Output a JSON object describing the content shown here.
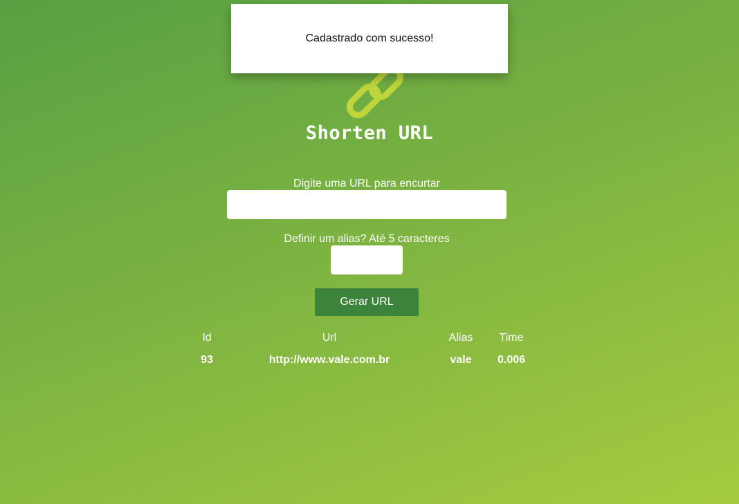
{
  "toast": {
    "message": "Cadastrado com sucesso!"
  },
  "header": {
    "logo_icon": "chain-link-icon",
    "title": "Shorten URL"
  },
  "form": {
    "url_label": "Digite uma URL para encurtar",
    "url_value": "",
    "alias_label": "Definir um alias? Até 5 caracteres",
    "alias_value": "",
    "submit_label": "Gerar URL"
  },
  "table": {
    "columns": [
      "Id",
      "Url",
      "Alias",
      "Time"
    ],
    "rows": [
      [
        "93",
        "http://www.vale.com.br",
        "vale",
        "0.006"
      ]
    ]
  },
  "colors": {
    "background_start": "#58a043",
    "background_end": "#a6cb40",
    "button": "#3c833b",
    "logo": "#c3d83b"
  }
}
